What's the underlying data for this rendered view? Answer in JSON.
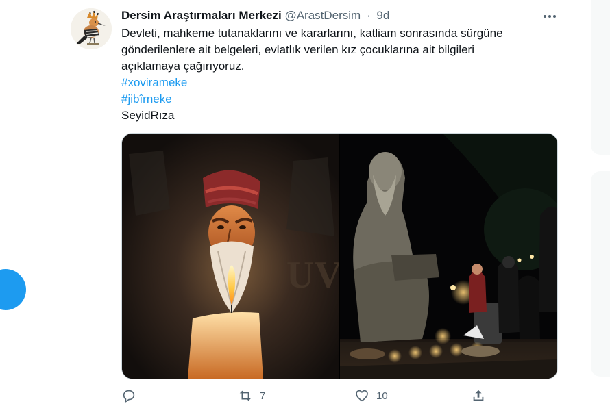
{
  "tweet": {
    "author_name": "Dersim Araştırmaları Merkezi",
    "handle": "@ArastDersim",
    "separator": "·",
    "time": "9d",
    "text_lines": [
      "Devleti, mahkeme tutanaklarını ve kararlarını, katliam sonrasında sürgüne",
      "gönderilenlere ait belgeleri, evlatlık verilen kız çocuklarına ait bilgileri",
      "açıklamaya çağırıyoruz."
    ],
    "hashtags": [
      "#xovirameke",
      "#jibîrneke"
    ],
    "signature": "SeyidRıza",
    "media_icons": [
      "candle-portrait-photo",
      "statue-vigil-photo"
    ],
    "actions": {
      "reply_icon": "reply-icon",
      "retweet_icon": "retweet-icon",
      "retweet_count": "7",
      "like_icon": "heart-icon",
      "like_count": "10",
      "share_icon": "share-icon"
    },
    "more_icon": "more-icon"
  },
  "colors": {
    "link": "#1d9bf0",
    "secondary_text": "#536471",
    "primary_text": "#0f1419",
    "fab": "#1d9bf0"
  }
}
